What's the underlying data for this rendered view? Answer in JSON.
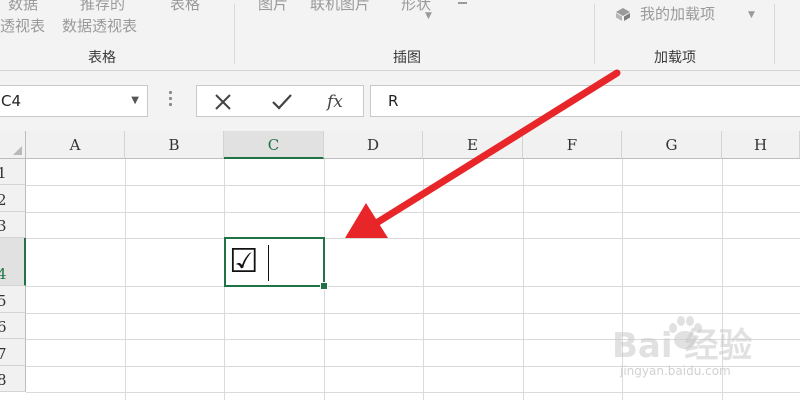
{
  "ribbon": {
    "items": [
      {
        "line1": "数据",
        "line2": "透视表"
      },
      {
        "line1": "推荐的",
        "line2": "数据透视表"
      },
      {
        "line1": "表格",
        "line2": ""
      },
      {
        "line1": "图片",
        "line2": ""
      },
      {
        "line1": "联机图片",
        "line2": ""
      },
      {
        "line1": "形状",
        "line2": ""
      }
    ],
    "addins_label": "我的加载项",
    "groups": [
      "表格",
      "插图",
      "加载项"
    ]
  },
  "formula_bar": {
    "name_box": "C4",
    "cancel_icon": "close-icon",
    "enter_icon": "checkmark-icon",
    "fx_label": "fx",
    "value": "R"
  },
  "sheet": {
    "columns": [
      "A",
      "B",
      "C",
      "D",
      "E",
      "F",
      "G",
      "H"
    ],
    "rows": [
      "1",
      "2",
      "3",
      "4",
      "5",
      "6",
      "7",
      "8"
    ],
    "active_column": "C",
    "active_row": "4",
    "active_cell": {
      "ref": "C4",
      "content": "☑"
    }
  },
  "watermark": {
    "logo": "Bai  经验",
    "url": "jingyan.baidu.com"
  },
  "colors": {
    "accent": "#217346",
    "arrow": "#e8262a"
  }
}
